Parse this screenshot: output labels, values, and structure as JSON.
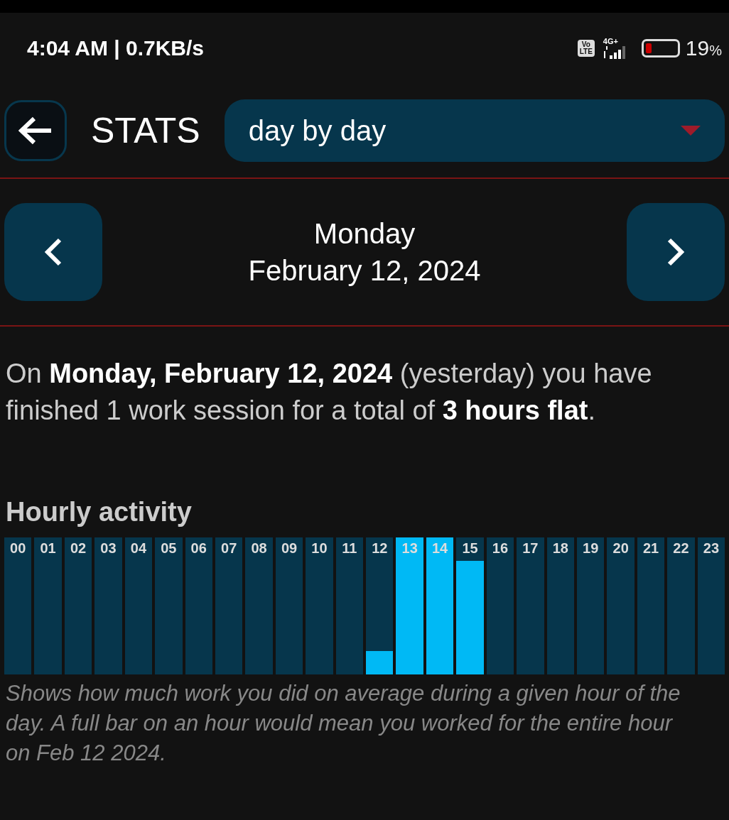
{
  "status_bar": {
    "time": "4:04 AM | 0.7KB/s",
    "volte": [
      "Vo",
      "LTE"
    ],
    "network": "4G+",
    "battery": "19",
    "battery_unit": "%"
  },
  "header": {
    "title": "STATS",
    "dropdown": "day by day"
  },
  "date_nav": {
    "weekday": "Monday",
    "date": "February 12, 2024"
  },
  "summary": "On **Monday, February 12, 2024** (yesterday) you have finished 1 work session for a total of **3 hours flat**.",
  "hourly": {
    "title": "Hourly activity",
    "hours": [
      {
        "label": "00"
      },
      {
        "label": "01"
      },
      {
        "label": "02"
      },
      {
        "label": "03"
      },
      {
        "label": "04"
      },
      {
        "label": "05"
      },
      {
        "label": "06"
      },
      {
        "label": "07"
      },
      {
        "label": "08"
      },
      {
        "label": "09"
      },
      {
        "label": "10"
      },
      {
        "label": "11"
      },
      {
        "label": "12",
        "level": 0.17
      },
      {
        "label": "13",
        "level": 1
      },
      {
        "label": "14",
        "level": 1
      },
      {
        "label": "15",
        "level": 0.83
      },
      {
        "label": "16"
      },
      {
        "label": "17"
      },
      {
        "label": "18"
      },
      {
        "label": "19"
      },
      {
        "label": "20"
      },
      {
        "label": "21"
      },
      {
        "label": "22"
      },
      {
        "label": "23"
      }
    ],
    "caption": "Shows how much work you did on average during a given hour of the day. A full bar on an hour would mean you worked for the entire hour on Feb 12 2024."
  }
}
